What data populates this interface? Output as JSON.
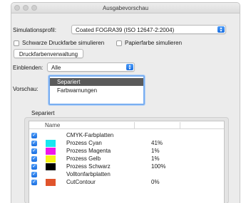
{
  "window": {
    "title": "Ausgabevorschau"
  },
  "simulation": {
    "label": "Simulationsprofil:",
    "value": "Coated FOGRA39 (ISO 12647-2:2004)"
  },
  "options": {
    "black_ink": "Schwarze Druckfarbe simulieren",
    "paper_color": "Papierfarbe simulieren",
    "ink_manager_button": "Druckfarbenverwaltung"
  },
  "show": {
    "label": "Einblenden:",
    "value": "Alle"
  },
  "preview": {
    "label": "Vorschau:",
    "items": [
      {
        "label": "Separiert",
        "selected": true
      },
      {
        "label": "Farbwarnungen",
        "selected": false
      }
    ]
  },
  "separations": {
    "group_label": "Separiert",
    "columns": [
      "Name",
      "",
      ""
    ],
    "rows": [
      {
        "name": "CMYK-Farbplatten",
        "value": "",
        "swatch": "",
        "checked": true
      },
      {
        "name": "Prozess Cyan",
        "value": "41%",
        "swatch": "#19e6f0",
        "checked": true
      },
      {
        "name": "Prozess Magenta",
        "value": "1%",
        "swatch": "#ee18ea",
        "checked": true
      },
      {
        "name": "Prozess Gelb",
        "value": "1%",
        "swatch": "#f6f416",
        "checked": true
      },
      {
        "name": "Prozess Schwarz",
        "value": "100%",
        "swatch": "#000000",
        "checked": true
      },
      {
        "name": "Volltonfarbplatten",
        "value": "",
        "swatch": "",
        "checked": true
      },
      {
        "name": "CutContour",
        "value": "0%",
        "swatch": "#e0542c",
        "checked": true
      }
    ]
  }
}
